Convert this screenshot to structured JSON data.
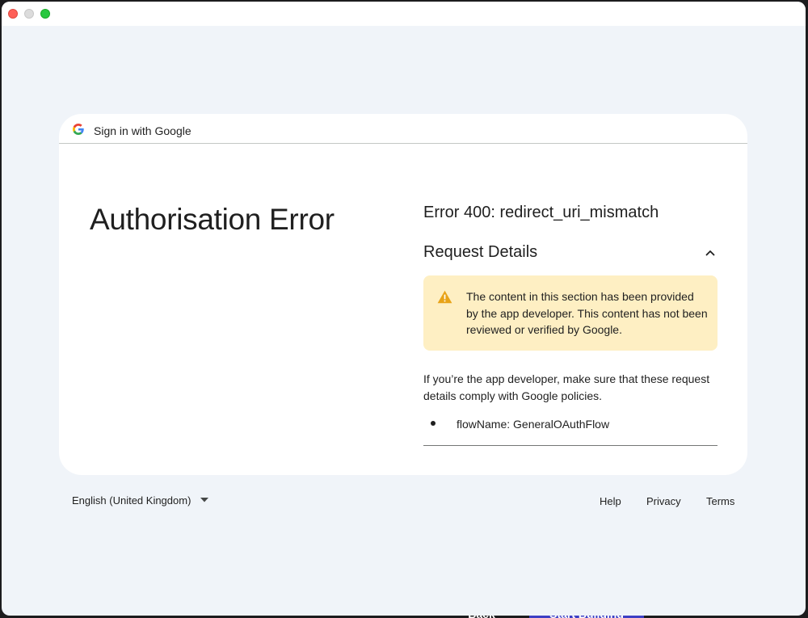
{
  "header": {
    "title": "Sign in with Google",
    "logo_icon": "google-g-icon"
  },
  "main": {
    "heading": "Authorisation Error",
    "error_title": "Error 400: redirect_uri_mismatch",
    "request_details_title": "Request Details",
    "warning_text": "The content in this section has been provided by the app developer. This content has not been reviewed or verified by Google.",
    "developer_text": "If you’re the app developer, make sure that these request details comply with Google policies.",
    "details": [
      {
        "text": "flowName: GeneralOAuthFlow"
      }
    ]
  },
  "footer": {
    "language": "English (United Kingdom)",
    "links": {
      "help": "Help",
      "privacy": "Privacy",
      "terms": "Terms"
    }
  },
  "background_app": {
    "back_label": "Back",
    "start_label": "Start Building"
  },
  "colors": {
    "page_bg": "#f0f4f9",
    "card_bg": "#ffffff",
    "warning_bg": "#feefc3",
    "warning_icon": "#e8a317",
    "text": "#1f1f1f"
  }
}
